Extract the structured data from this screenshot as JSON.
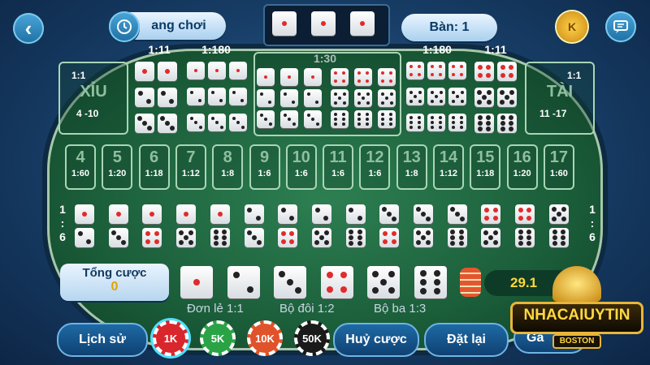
{
  "topbar": {
    "back_icon": "chevron-left-icon",
    "history_label": "ang chơi",
    "table_label": "Bàn: 1",
    "coin_label": "K",
    "chat_icon": "chat-icon"
  },
  "odds_top": [
    "1:11",
    "1:180",
    "1:30",
    "1:180",
    "1:11"
  ],
  "xiu": {
    "odds": "1:1",
    "title": "XỈU",
    "range": "4 -10"
  },
  "tai": {
    "odds": "1:1",
    "title": "TÀI",
    "range": "11 -17"
  },
  "numbers": [
    {
      "n": "4",
      "o": "1:60"
    },
    {
      "n": "5",
      "o": "1:20"
    },
    {
      "n": "6",
      "o": "1:18"
    },
    {
      "n": "7",
      "o": "1:12"
    },
    {
      "n": "8",
      "o": "1:8"
    },
    {
      "n": "9",
      "o": "1:6"
    },
    {
      "n": "10",
      "o": "1:6"
    },
    {
      "n": "11",
      "o": "1:6"
    },
    {
      "n": "12",
      "o": "1:6"
    },
    {
      "n": "13",
      "o": "1:8"
    },
    {
      "n": "14",
      "o": "1:12"
    },
    {
      "n": "15",
      "o": "1:18"
    },
    {
      "n": "16",
      "o": "1:20"
    },
    {
      "n": "17",
      "o": "1:60"
    }
  ],
  "combo_odds_left": "1\n:\n6",
  "combo_odds_right": "1\n:\n6",
  "total_bet": {
    "label": "Tổng cược",
    "value": "0"
  },
  "balance": "29.1",
  "legend": {
    "single": "Đơn lẻ 1:1",
    "double": "Bộ đôi 1:2",
    "triple": "Bộ ba 1:3"
  },
  "buttons": {
    "history": "Lịch sử",
    "cancel": "Huỷ cược",
    "reset": "Đặt lại",
    "partial": "Gấ"
  },
  "chips": [
    {
      "label": "1K",
      "color": "#d8262c"
    },
    {
      "label": "5K",
      "color": "#2aa346"
    },
    {
      "label": "10K",
      "color": "#e0532a"
    },
    {
      "label": "50K",
      "color": "#1a1a1a"
    }
  ],
  "logo": {
    "text": "NHACAIUYTIN",
    "sub": "BOSTON"
  },
  "colors": {
    "accent": "#ffd83a",
    "felt": "#1b5e3a"
  }
}
